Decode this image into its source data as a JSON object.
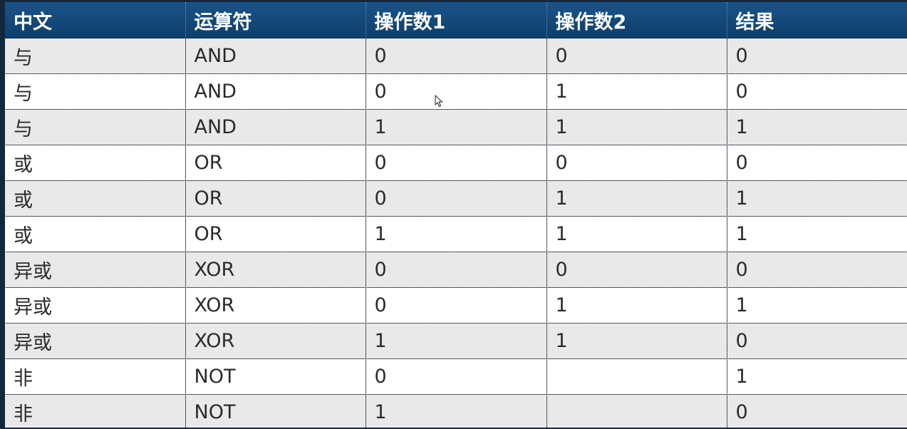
{
  "table": {
    "headers": [
      "中文",
      "运算符",
      "操作数1",
      "操作数2",
      "结果"
    ],
    "rows": [
      [
        "与",
        "AND",
        "0",
        "0",
        "0"
      ],
      [
        "与",
        "AND",
        "0",
        "1",
        "0"
      ],
      [
        "与",
        "AND",
        "1",
        "1",
        "1"
      ],
      [
        "或",
        "OR",
        "0",
        "0",
        "0"
      ],
      [
        "或",
        "OR",
        "0",
        "1",
        "1"
      ],
      [
        "或",
        "OR",
        "1",
        "1",
        "1"
      ],
      [
        "异或",
        "XOR",
        "0",
        "0",
        "0"
      ],
      [
        "异或",
        "XOR",
        "0",
        "1",
        "1"
      ],
      [
        "异或",
        "XOR",
        "1",
        "1",
        "0"
      ],
      [
        "非",
        "NOT",
        "0",
        "",
        "1"
      ],
      [
        "非",
        "NOT",
        "1",
        "",
        "0"
      ]
    ]
  },
  "colors": {
    "header_bg": "#0e3f6c",
    "header_text": "#ffffff",
    "row_odd": "#e9e9e9",
    "row_even": "#ffffff",
    "cell_text": "#2b2b2b"
  },
  "icons": {
    "cursor": "mouse-pointer-icon"
  }
}
